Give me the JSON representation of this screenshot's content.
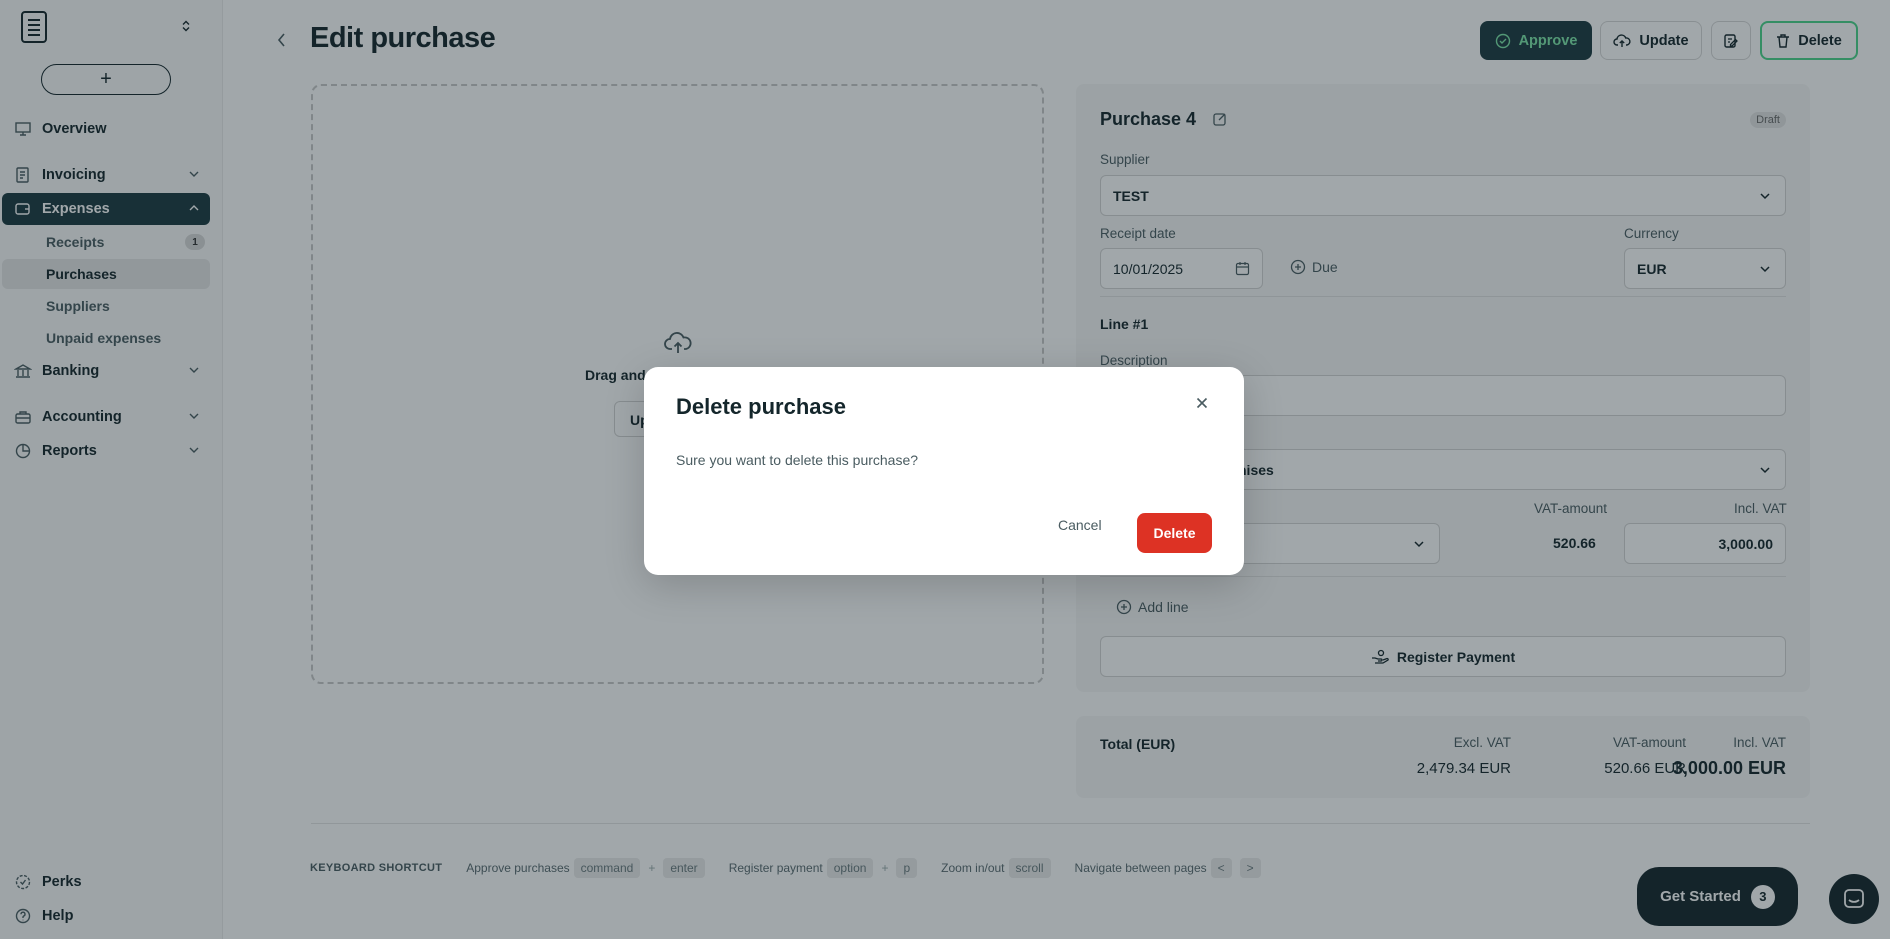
{
  "sidebar": {
    "new_button": "+",
    "items": [
      {
        "label": "Overview"
      },
      {
        "label": "Invoicing"
      },
      {
        "label": "Expenses"
      },
      {
        "label": "Banking"
      },
      {
        "label": "Accounting"
      },
      {
        "label": "Reports"
      }
    ],
    "expenses_sub": [
      {
        "label": "Receipts",
        "badge": "1"
      },
      {
        "label": "Purchases"
      },
      {
        "label": "Suppliers"
      },
      {
        "label": "Unpaid expenses"
      }
    ],
    "bottom": [
      {
        "label": "Perks"
      },
      {
        "label": "Help"
      }
    ]
  },
  "header": {
    "title": "Edit purchase",
    "approve": "Approve",
    "update": "Update",
    "delete": "Delete"
  },
  "upload": {
    "drag_text": "Drag and",
    "upload_btn": "Up"
  },
  "purchase": {
    "title": "Purchase 4",
    "status": "Draft",
    "supplier_label": "Supplier",
    "supplier_value": "TEST",
    "receipt_date_label": "Receipt date",
    "receipt_date_value": "10/01/2025",
    "due_label": "Due",
    "currency_label": "Currency",
    "currency_value": "EUR",
    "line_title": "Line #1",
    "description_label": "Description",
    "category_partial": "nises",
    "vat_amount_label": "VAT-amount",
    "vat_amount_value": "520.66",
    "incl_vat_label": "Incl. VAT",
    "incl_vat_value": "3,000.00",
    "add_line": "Add line",
    "register_payment": "Register Payment"
  },
  "totals": {
    "label": "Total (EUR)",
    "excl_label": "Excl. VAT",
    "excl_value": "2,479.34 EUR",
    "vat_label": "VAT-amount",
    "vat_value": "520.66 EUR",
    "incl_label": "Incl. VAT",
    "incl_value": "3,000.00 EUR"
  },
  "shortcuts": {
    "title": "KEYBOARD SHORTCUT",
    "approve_label": "Approve purchases",
    "approve_k1": "command",
    "approve_k2": "enter",
    "payment_label": "Register payment",
    "payment_k1": "option",
    "payment_k2": "p",
    "zoom_label": "Zoom in/out",
    "zoom_k": "scroll",
    "nav_label": "Navigate between pages",
    "nav_k1": "<",
    "nav_k2": ">",
    "plus": "+"
  },
  "get_started": {
    "label": "Get Started",
    "count": "3"
  },
  "modal": {
    "title": "Delete purchase",
    "text": "Sure you want to delete this purchase?",
    "cancel": "Cancel",
    "delete": "Delete"
  }
}
